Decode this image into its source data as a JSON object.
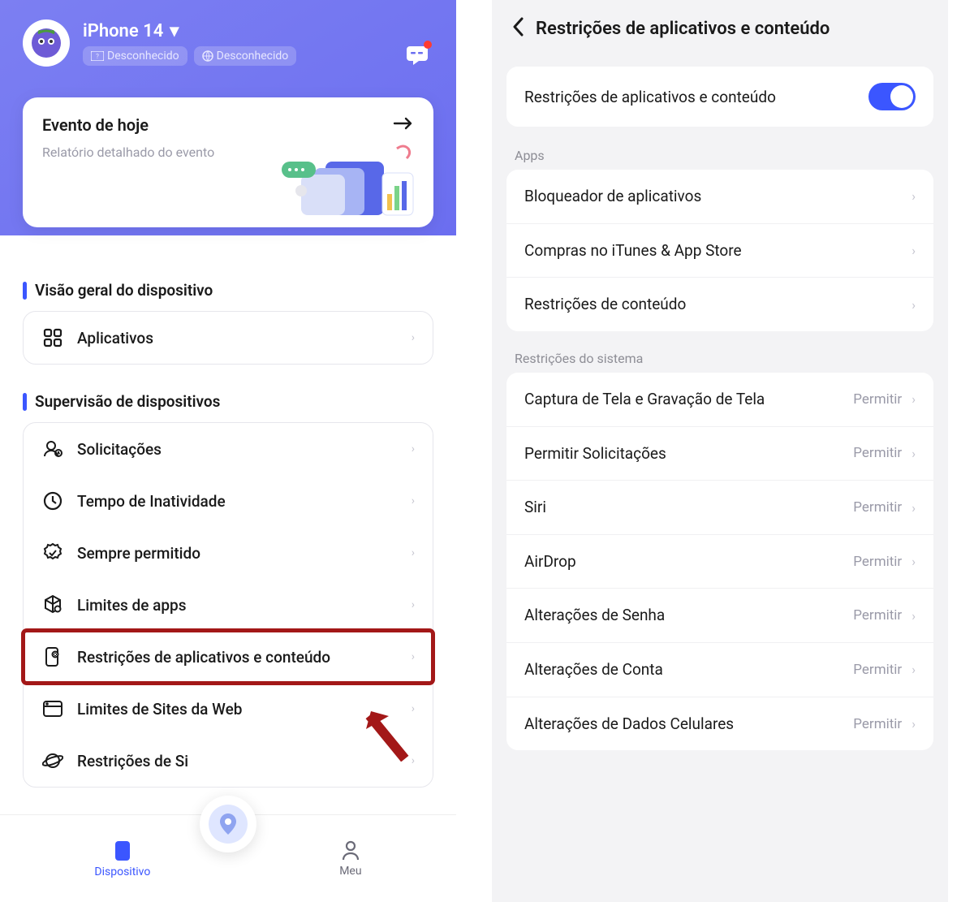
{
  "left": {
    "device_name": "iPhone 14",
    "badge1": "Desconhecido",
    "badge2": "Desconhecido",
    "event_title": "Evento de hoje",
    "event_subtitle": "Relatório detalhado do evento",
    "section1_title": "Visão geral do dispositivo",
    "section1_items": [
      {
        "label": "Aplicativos"
      }
    ],
    "section2_title": "Supervisão de dispositivos",
    "section2_items": [
      {
        "label": "Solicitações"
      },
      {
        "label": "Tempo de Inatividade"
      },
      {
        "label": "Sempre permitido"
      },
      {
        "label": "Limites de apps"
      },
      {
        "label": "Restrições de aplicativos e conteúdo"
      },
      {
        "label": "Limites de Sites da Web"
      },
      {
        "label": "Restrições de Si"
      }
    ],
    "nav": {
      "device": "Dispositivo",
      "me": "Meu"
    }
  },
  "right": {
    "title": "Restrições de aplicativos e conteúdo",
    "toggle_label": "Restrições de aplicativos e conteúdo",
    "group1_label": "Apps",
    "group1_items": [
      {
        "label": "Bloqueador de aplicativos"
      },
      {
        "label": "Compras no iTunes & App Store"
      },
      {
        "label": "Restrições de conteúdo"
      }
    ],
    "group2_label": "Restrições do sistema",
    "allow": "Permitir",
    "group2_items": [
      {
        "label": "Captura de Tela e Gravação de Tela"
      },
      {
        "label": "Permitir Solicitações"
      },
      {
        "label": "Siri"
      },
      {
        "label": "AirDrop"
      },
      {
        "label": "Alterações de Senha"
      },
      {
        "label": "Alterações de Conta"
      },
      {
        "label": "Alterações de Dados Celulares"
      }
    ]
  }
}
